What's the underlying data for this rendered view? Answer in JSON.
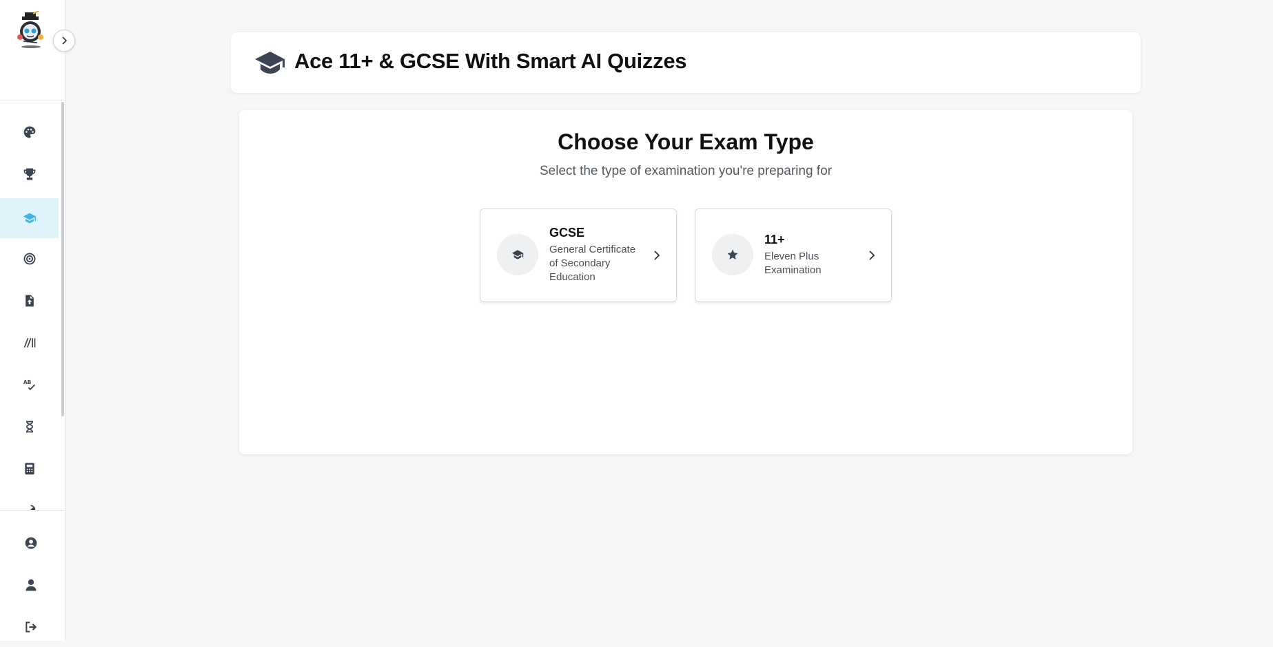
{
  "header": {
    "title": "Ace 11+ & GCSE With Smart AI Quizzes",
    "icon": "graduation-cap-icon"
  },
  "main": {
    "title": "Choose Your Exam Type",
    "subtitle": "Select the type of examination you're preparing for",
    "exam_options": [
      {
        "name": "GCSE",
        "description": "General Certificate of Secondary Education",
        "icon": "graduation-cap-icon"
      },
      {
        "name": "11+",
        "description": "Eleven Plus Examination",
        "icon": "star-icon"
      }
    ]
  },
  "sidebar": {
    "nav_items": [
      {
        "icon": "palette-icon",
        "active": false
      },
      {
        "icon": "trophy-icon",
        "active": false
      },
      {
        "icon": "graduation-cap-icon",
        "active": true
      },
      {
        "icon": "target-icon",
        "active": false
      },
      {
        "icon": "file-upload-icon",
        "active": false
      },
      {
        "icon": "slashes-icon",
        "active": false
      },
      {
        "icon": "spell-check-icon",
        "active": false
      },
      {
        "icon": "hourglass-icon",
        "active": false
      },
      {
        "icon": "calculator-icon",
        "active": false
      },
      {
        "icon": "rocket-icon",
        "active": false
      }
    ],
    "bottom_items": [
      {
        "icon": "user-circle-icon"
      },
      {
        "icon": "user-icon"
      },
      {
        "icon": "logout-icon"
      }
    ]
  },
  "colors": {
    "page_background": "#f5f6f8",
    "active_nav_background": "#dff3fb",
    "active_nav_icon": "#3fb6e2",
    "icon": "#3d4451"
  }
}
